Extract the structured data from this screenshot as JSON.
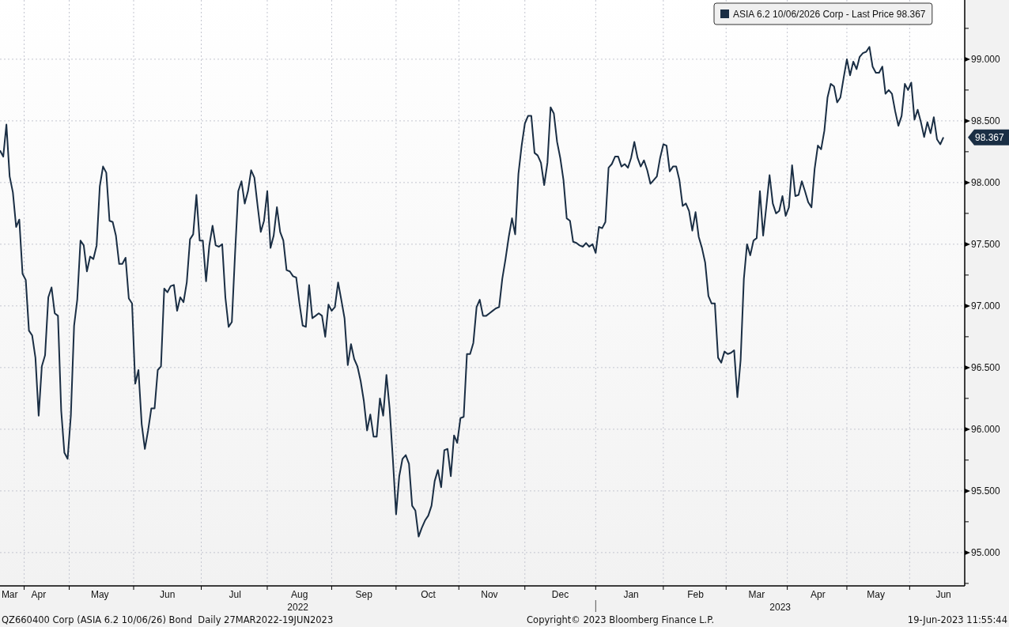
{
  "chart": {
    "last_value_label": "98.367",
    "chart_data": {
      "type": "line",
      "grid": true,
      "ylim": [
        94.73,
        99.48
      ],
      "categories": [
        null,
        null,
        null,
        "Mar",
        null,
        null,
        null,
        null,
        null,
        null,
        null,
        null,
        "Apr",
        null,
        null,
        null,
        null,
        null,
        null,
        null,
        null,
        null,
        null,
        null,
        null,
        null,
        null,
        null,
        null,
        null,
        null,
        "May",
        null,
        null,
        null,
        null,
        null,
        null,
        null,
        null,
        null,
        null,
        null,
        null,
        null,
        null,
        null,
        null,
        null,
        null,
        null,
        null,
        "Jun",
        null,
        null,
        null,
        null,
        null,
        null,
        null,
        null,
        null,
        null,
        null,
        null,
        null,
        null,
        null,
        null,
        null,
        null,
        null,
        null,
        "Jul",
        null,
        null,
        null,
        null,
        null,
        null,
        null,
        null,
        null,
        null,
        null,
        null,
        null,
        null,
        null,
        null,
        null,
        null,
        null,
        "Aug",
        null,
        null,
        null,
        null,
        null,
        null,
        null,
        null,
        null,
        null,
        null,
        null,
        null,
        null,
        null,
        null,
        null,
        null,
        null,
        "Sep",
        null,
        null,
        null,
        null,
        null,
        null,
        null,
        null,
        null,
        null,
        null,
        null,
        null,
        null,
        null,
        null,
        null,
        null,
        null,
        "Oct",
        null,
        null,
        null,
        null,
        null,
        null,
        null,
        null,
        null,
        null,
        null,
        null,
        null,
        null,
        null,
        null,
        null,
        null,
        "Nov",
        null,
        null,
        null,
        null,
        null,
        null,
        null,
        null,
        null,
        null,
        null,
        null,
        null,
        null,
        null,
        null,
        null,
        null,
        null,
        null,
        null,
        "Dec",
        null,
        null,
        null,
        null,
        null,
        null,
        null,
        null,
        null,
        null,
        null,
        null,
        null,
        null,
        null,
        null,
        null,
        null,
        null,
        null,
        null,
        "Jan",
        null,
        null,
        null,
        null,
        null,
        null,
        null,
        null,
        null,
        null,
        null,
        null,
        null,
        null,
        null,
        null,
        null,
        null,
        null,
        "Feb",
        null,
        null,
        null,
        null,
        null,
        null,
        null,
        null,
        null,
        null,
        null,
        null,
        null,
        null,
        null,
        null,
        null,
        null,
        "Mar",
        null,
        null,
        null,
        null,
        null,
        null,
        null,
        null,
        null,
        null,
        null,
        null,
        null,
        null,
        null,
        null,
        null,
        null,
        "Apr",
        null,
        null,
        null,
        null,
        null,
        null,
        null,
        null,
        null,
        null,
        null,
        null,
        null,
        null,
        null,
        null,
        null,
        "May",
        null,
        null,
        null,
        null,
        null,
        null,
        null,
        null,
        null,
        null,
        null,
        null,
        null,
        null,
        null,
        null,
        null,
        null,
        null,
        null,
        "Jun"
      ],
      "yticks": [
        {
          "value": 95,
          "label": "95.000"
        },
        {
          "value": 95.5,
          "label": "95.500"
        },
        {
          "value": 96,
          "label": "96.000"
        },
        {
          "value": 96.5,
          "label": "96.500"
        },
        {
          "value": 97,
          "label": "97.000"
        },
        {
          "value": 97.5,
          "label": "97.500"
        },
        {
          "value": 98,
          "label": "98.000"
        },
        {
          "value": 98.5,
          "label": "98.500"
        },
        {
          "value": 99,
          "label": "99.000"
        }
      ],
      "annotations": [
        "2022",
        "2023"
      ],
      "series": [
        {
          "name": "ASIA 6.2 10/06/2026 Corp - Last Price 98.367",
          "color": "#1a2e44",
          "values": [
            98.26,
            98.21,
            98.47,
            98.05,
            97.92,
            97.64,
            97.7,
            97.26,
            97.21,
            96.8,
            96.76,
            96.58,
            96.11,
            96.51,
            96.6,
            97.07,
            97.15,
            96.94,
            96.92,
            96.15,
            95.81,
            95.76,
            96.11,
            96.84,
            97.05,
            97.53,
            97.49,
            97.28,
            97.4,
            97.38,
            97.49,
            97.97,
            98.13,
            98.08,
            97.69,
            97.68,
            97.57,
            97.34,
            97.34,
            97.39,
            97.06,
            97.02,
            96.37,
            96.48,
            96.04,
            95.84,
            95.99,
            96.17,
            96.17,
            96.48,
            96.51,
            97.14,
            97.11,
            97.16,
            97.17,
            96.96,
            97.07,
            97.03,
            97.19,
            97.54,
            97.58,
            97.9,
            97.53,
            97.53,
            97.2,
            97.49,
            97.65,
            97.49,
            97.48,
            97.5,
            97.07,
            96.83,
            96.87,
            97.43,
            97.93,
            98.01,
            97.83,
            97.93,
            98.1,
            98.04,
            97.81,
            97.6,
            97.69,
            97.93,
            97.47,
            97.57,
            97.8,
            97.6,
            97.53,
            97.29,
            97.28,
            97.24,
            97.23,
            97.02,
            96.84,
            96.83,
            97.17,
            96.9,
            96.92,
            96.94,
            96.92,
            96.75,
            97.01,
            96.96,
            96.99,
            97.19,
            97.05,
            96.9,
            96.52,
            96.69,
            96.57,
            96.51,
            96.39,
            96.23,
            95.99,
            96.12,
            95.94,
            95.94,
            96.25,
            96.11,
            96.44,
            96.17,
            95.76,
            95.31,
            95.62,
            95.76,
            95.79,
            95.72,
            95.38,
            95.34,
            95.13,
            95.2,
            95.26,
            95.3,
            95.38,
            95.58,
            95.67,
            95.53,
            95.83,
            95.84,
            95.62,
            95.95,
            95.89,
            96.09,
            96.1,
            96.61,
            96.61,
            96.7,
            96.99,
            97.05,
            96.92,
            96.92,
            96.94,
            96.96,
            96.98,
            96.99,
            97.22,
            97.38,
            97.56,
            97.71,
            97.58,
            98.07,
            98.3,
            98.48,
            98.54,
            98.54,
            98.24,
            98.22,
            98.16,
            97.98,
            98.16,
            98.61,
            98.56,
            98.33,
            98.2,
            98.02,
            97.71,
            97.69,
            97.52,
            97.51,
            97.49,
            97.48,
            97.51,
            97.48,
            97.5,
            97.43,
            97.64,
            97.63,
            97.68,
            98.12,
            98.15,
            98.21,
            98.21,
            98.13,
            98.15,
            98.12,
            98.2,
            98.33,
            98.2,
            98.13,
            98.18,
            98.1,
            97.99,
            98.02,
            98.05,
            98.2,
            98.31,
            98.3,
            98.09,
            98.13,
            98.13,
            98.02,
            97.81,
            97.83,
            97.77,
            97.61,
            97.76,
            97.56,
            97.47,
            97.35,
            97.08,
            97.02,
            97.02,
            96.58,
            96.54,
            96.63,
            96.61,
            96.62,
            96.64,
            96.26,
            96.56,
            97.22,
            97.5,
            97.41,
            97.53,
            97.55,
            97.93,
            97.57,
            97.81,
            98.06,
            97.83,
            97.75,
            97.77,
            97.89,
            97.73,
            97.8,
            98.14,
            97.89,
            97.9,
            98.01,
            97.93,
            97.84,
            97.8,
            98.11,
            98.3,
            98.27,
            98.42,
            98.69,
            98.8,
            98.78,
            98.65,
            98.69,
            98.85,
            99.0,
            98.87,
            98.98,
            98.92,
            99.02,
            99.05,
            99.06,
            99.1,
            98.94,
            98.89,
            98.89,
            98.94,
            98.72,
            98.75,
            98.72,
            98.58,
            98.46,
            98.54,
            98.8,
            98.75,
            98.81,
            98.51,
            98.59,
            98.49,
            98.37,
            98.49,
            98.4,
            98.53,
            98.35,
            98.31,
            98.367
          ]
        }
      ]
    }
  },
  "footer": {
    "security": "QZ660400 Corp (ASIA 6.2 10/06/26) Bond  Daily 27MAR2022-19JUN2023",
    "copyright": "Copyright© 2023 Bloomberg Finance L.P.",
    "timestamp": "19-Jun-2023 11:55:44"
  }
}
